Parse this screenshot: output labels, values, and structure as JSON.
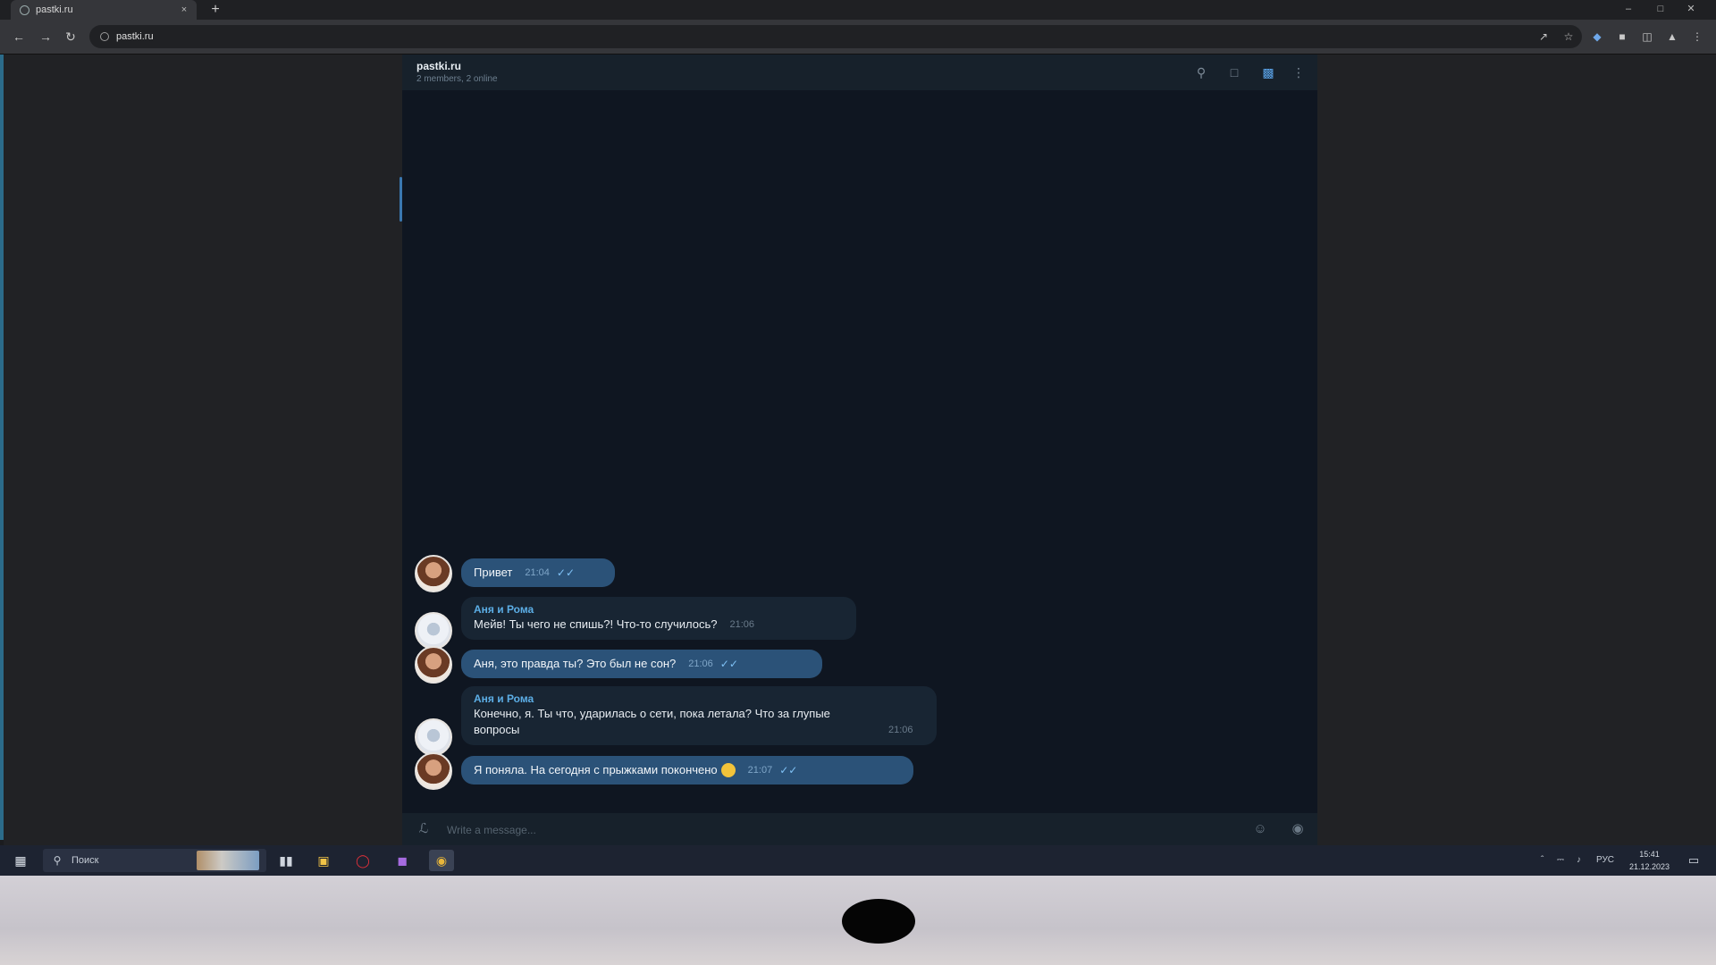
{
  "browser": {
    "tab_title": "pastki.ru",
    "tab_close": "×",
    "new_tab": "+",
    "url": "pastki.ru",
    "nav": {
      "back": "←",
      "forward": "→",
      "reload": "↻"
    }
  },
  "chat": {
    "title": "pastki.ru",
    "subtitle": "2 members, 2 online",
    "header_icons": [
      "search-icon",
      "chat-icon",
      "sidebar-icon",
      "more-icon"
    ],
    "messages": [
      {
        "sender": "",
        "text": "Привет",
        "time": "21:04",
        "outgoing": true
      },
      {
        "sender": "Аня и Рома",
        "text": "Мейв! Ты чего не спишь?! Что-то случилось?",
        "time": "21:06",
        "outgoing": false
      },
      {
        "sender": "",
        "text": "Аня, это правда ты? Это был не сон?",
        "time": "21:06",
        "outgoing": true
      },
      {
        "sender": "Аня и Рома",
        "text": "Конечно, я. Ты что, ударилась о сети, пока летала? Что за глупые вопросы",
        "time": "21:06",
        "outgoing": false
      },
      {
        "sender": "",
        "text": "Я поняла. На сегодня с прыжками покончено",
        "time": "21:07",
        "outgoing": true
      }
    ],
    "composer_placeholder": "Write a message..."
  },
  "taskbar": {
    "search_placeholder": "Поиск",
    "tray_lang": "РУС",
    "clock_time": "15:41",
    "clock_date": "21.12.2023"
  },
  "colors": {
    "outgoing_bubble": "#2b5278",
    "incoming_bubble": "#182533",
    "sender_name": "#5caee6",
    "chat_background": "#0f1621"
  }
}
